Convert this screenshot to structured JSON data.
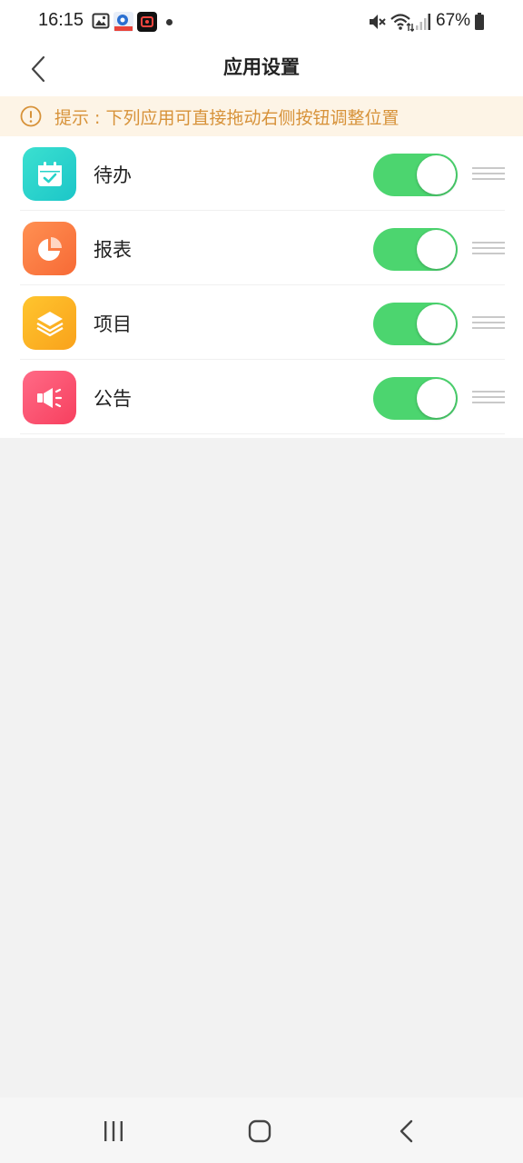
{
  "status_bar": {
    "time": "16:15",
    "battery": "67%"
  },
  "header": {
    "title": "应用设置"
  },
  "tip": {
    "text": "提示 : 下列应用可直接拖动右侧按钮调整位置"
  },
  "apps": [
    {
      "label": "待办",
      "enabled": true,
      "icon": "calendar-check-icon",
      "color": "#26d3c9"
    },
    {
      "label": "报表",
      "enabled": true,
      "icon": "pie-chart-icon",
      "color": "#fb7a3e"
    },
    {
      "label": "项目",
      "enabled": true,
      "icon": "layers-icon",
      "color": "#fbb224"
    },
    {
      "label": "公告",
      "enabled": true,
      "icon": "megaphone-icon",
      "color": "#fb5272"
    }
  ],
  "colors": {
    "toggle_on": "#4cd56f",
    "tip_text": "#d79239",
    "tip_bg": "#fdf4e6",
    "page_bg": "#f2f2f2"
  }
}
